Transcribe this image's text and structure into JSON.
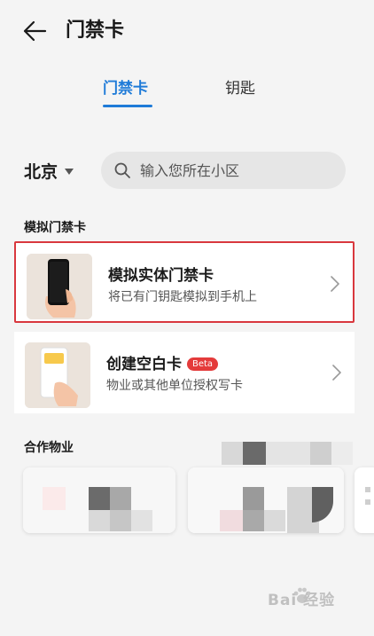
{
  "header": {
    "title": "门禁卡",
    "back_icon": "arrow-left-icon"
  },
  "tabs": [
    {
      "label": "门禁卡",
      "active": true
    },
    {
      "label": "钥匙",
      "active": false
    }
  ],
  "location": {
    "city": "北京"
  },
  "search": {
    "placeholder": "输入您所在小区"
  },
  "sections": {
    "simulated": "模拟门禁卡",
    "partners": "合作物业"
  },
  "cards": [
    {
      "title": "模拟实体门禁卡",
      "subtitle": "将已有门钥匙模拟到手机上",
      "highlighted": true
    },
    {
      "title": "创建空白卡",
      "badge": "Beta",
      "subtitle": "物业或其他单位授权写卡"
    }
  ],
  "watermark": {
    "text": "Bai 经验"
  },
  "colors": {
    "accent": "#1f7bd8",
    "highlight_border": "#d9383e",
    "badge": "#e43b3b"
  }
}
